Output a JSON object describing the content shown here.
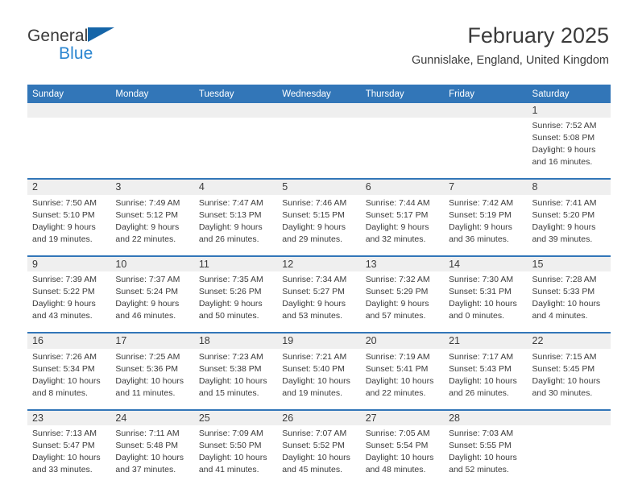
{
  "brand": {
    "name_top": "General",
    "name_bottom": "Blue",
    "triangle_color": "#1565a8",
    "bottom_color": "#2a85d0"
  },
  "header": {
    "title": "February 2025",
    "location": "Gunnislake, England, United Kingdom"
  },
  "theme": {
    "header_blue": "#3276b8",
    "date_band_gray": "#efefef",
    "text": "#3b3b3b"
  },
  "weekday_headers": [
    "Sunday",
    "Monday",
    "Tuesday",
    "Wednesday",
    "Thursday",
    "Friday",
    "Saturday"
  ],
  "weeks": [
    {
      "days": [
        {
          "date": "",
          "sunrise": "",
          "sunset": "",
          "daylight_line1": "",
          "daylight_line2": "",
          "empty": true
        },
        {
          "date": "",
          "sunrise": "",
          "sunset": "",
          "daylight_line1": "",
          "daylight_line2": "",
          "empty": true
        },
        {
          "date": "",
          "sunrise": "",
          "sunset": "",
          "daylight_line1": "",
          "daylight_line2": "",
          "empty": true
        },
        {
          "date": "",
          "sunrise": "",
          "sunset": "",
          "daylight_line1": "",
          "daylight_line2": "",
          "empty": true
        },
        {
          "date": "",
          "sunrise": "",
          "sunset": "",
          "daylight_line1": "",
          "daylight_line2": "",
          "empty": true
        },
        {
          "date": "",
          "sunrise": "",
          "sunset": "",
          "daylight_line1": "",
          "daylight_line2": "",
          "empty": true
        },
        {
          "date": "1",
          "sunrise": "Sunrise: 7:52 AM",
          "sunset": "Sunset: 5:08 PM",
          "daylight_line1": "Daylight: 9 hours",
          "daylight_line2": "and 16 minutes.",
          "empty": false
        }
      ]
    },
    {
      "days": [
        {
          "date": "2",
          "sunrise": "Sunrise: 7:50 AM",
          "sunset": "Sunset: 5:10 PM",
          "daylight_line1": "Daylight: 9 hours",
          "daylight_line2": "and 19 minutes.",
          "empty": false
        },
        {
          "date": "3",
          "sunrise": "Sunrise: 7:49 AM",
          "sunset": "Sunset: 5:12 PM",
          "daylight_line1": "Daylight: 9 hours",
          "daylight_line2": "and 22 minutes.",
          "empty": false
        },
        {
          "date": "4",
          "sunrise": "Sunrise: 7:47 AM",
          "sunset": "Sunset: 5:13 PM",
          "daylight_line1": "Daylight: 9 hours",
          "daylight_line2": "and 26 minutes.",
          "empty": false
        },
        {
          "date": "5",
          "sunrise": "Sunrise: 7:46 AM",
          "sunset": "Sunset: 5:15 PM",
          "daylight_line1": "Daylight: 9 hours",
          "daylight_line2": "and 29 minutes.",
          "empty": false
        },
        {
          "date": "6",
          "sunrise": "Sunrise: 7:44 AM",
          "sunset": "Sunset: 5:17 PM",
          "daylight_line1": "Daylight: 9 hours",
          "daylight_line2": "and 32 minutes.",
          "empty": false
        },
        {
          "date": "7",
          "sunrise": "Sunrise: 7:42 AM",
          "sunset": "Sunset: 5:19 PM",
          "daylight_line1": "Daylight: 9 hours",
          "daylight_line2": "and 36 minutes.",
          "empty": false
        },
        {
          "date": "8",
          "sunrise": "Sunrise: 7:41 AM",
          "sunset": "Sunset: 5:20 PM",
          "daylight_line1": "Daylight: 9 hours",
          "daylight_line2": "and 39 minutes.",
          "empty": false
        }
      ]
    },
    {
      "days": [
        {
          "date": "9",
          "sunrise": "Sunrise: 7:39 AM",
          "sunset": "Sunset: 5:22 PM",
          "daylight_line1": "Daylight: 9 hours",
          "daylight_line2": "and 43 minutes.",
          "empty": false
        },
        {
          "date": "10",
          "sunrise": "Sunrise: 7:37 AM",
          "sunset": "Sunset: 5:24 PM",
          "daylight_line1": "Daylight: 9 hours",
          "daylight_line2": "and 46 minutes.",
          "empty": false
        },
        {
          "date": "11",
          "sunrise": "Sunrise: 7:35 AM",
          "sunset": "Sunset: 5:26 PM",
          "daylight_line1": "Daylight: 9 hours",
          "daylight_line2": "and 50 minutes.",
          "empty": false
        },
        {
          "date": "12",
          "sunrise": "Sunrise: 7:34 AM",
          "sunset": "Sunset: 5:27 PM",
          "daylight_line1": "Daylight: 9 hours",
          "daylight_line2": "and 53 minutes.",
          "empty": false
        },
        {
          "date": "13",
          "sunrise": "Sunrise: 7:32 AM",
          "sunset": "Sunset: 5:29 PM",
          "daylight_line1": "Daylight: 9 hours",
          "daylight_line2": "and 57 minutes.",
          "empty": false
        },
        {
          "date": "14",
          "sunrise": "Sunrise: 7:30 AM",
          "sunset": "Sunset: 5:31 PM",
          "daylight_line1": "Daylight: 10 hours",
          "daylight_line2": "and 0 minutes.",
          "empty": false
        },
        {
          "date": "15",
          "sunrise": "Sunrise: 7:28 AM",
          "sunset": "Sunset: 5:33 PM",
          "daylight_line1": "Daylight: 10 hours",
          "daylight_line2": "and 4 minutes.",
          "empty": false
        }
      ]
    },
    {
      "days": [
        {
          "date": "16",
          "sunrise": "Sunrise: 7:26 AM",
          "sunset": "Sunset: 5:34 PM",
          "daylight_line1": "Daylight: 10 hours",
          "daylight_line2": "and 8 minutes.",
          "empty": false
        },
        {
          "date": "17",
          "sunrise": "Sunrise: 7:25 AM",
          "sunset": "Sunset: 5:36 PM",
          "daylight_line1": "Daylight: 10 hours",
          "daylight_line2": "and 11 minutes.",
          "empty": false
        },
        {
          "date": "18",
          "sunrise": "Sunrise: 7:23 AM",
          "sunset": "Sunset: 5:38 PM",
          "daylight_line1": "Daylight: 10 hours",
          "daylight_line2": "and 15 minutes.",
          "empty": false
        },
        {
          "date": "19",
          "sunrise": "Sunrise: 7:21 AM",
          "sunset": "Sunset: 5:40 PM",
          "daylight_line1": "Daylight: 10 hours",
          "daylight_line2": "and 19 minutes.",
          "empty": false
        },
        {
          "date": "20",
          "sunrise": "Sunrise: 7:19 AM",
          "sunset": "Sunset: 5:41 PM",
          "daylight_line1": "Daylight: 10 hours",
          "daylight_line2": "and 22 minutes.",
          "empty": false
        },
        {
          "date": "21",
          "sunrise": "Sunrise: 7:17 AM",
          "sunset": "Sunset: 5:43 PM",
          "daylight_line1": "Daylight: 10 hours",
          "daylight_line2": "and 26 minutes.",
          "empty": false
        },
        {
          "date": "22",
          "sunrise": "Sunrise: 7:15 AM",
          "sunset": "Sunset: 5:45 PM",
          "daylight_line1": "Daylight: 10 hours",
          "daylight_line2": "and 30 minutes.",
          "empty": false
        }
      ]
    },
    {
      "days": [
        {
          "date": "23",
          "sunrise": "Sunrise: 7:13 AM",
          "sunset": "Sunset: 5:47 PM",
          "daylight_line1": "Daylight: 10 hours",
          "daylight_line2": "and 33 minutes.",
          "empty": false
        },
        {
          "date": "24",
          "sunrise": "Sunrise: 7:11 AM",
          "sunset": "Sunset: 5:48 PM",
          "daylight_line1": "Daylight: 10 hours",
          "daylight_line2": "and 37 minutes.",
          "empty": false
        },
        {
          "date": "25",
          "sunrise": "Sunrise: 7:09 AM",
          "sunset": "Sunset: 5:50 PM",
          "daylight_line1": "Daylight: 10 hours",
          "daylight_line2": "and 41 minutes.",
          "empty": false
        },
        {
          "date": "26",
          "sunrise": "Sunrise: 7:07 AM",
          "sunset": "Sunset: 5:52 PM",
          "daylight_line1": "Daylight: 10 hours",
          "daylight_line2": "and 45 minutes.",
          "empty": false
        },
        {
          "date": "27",
          "sunrise": "Sunrise: 7:05 AM",
          "sunset": "Sunset: 5:54 PM",
          "daylight_line1": "Daylight: 10 hours",
          "daylight_line2": "and 48 minutes.",
          "empty": false
        },
        {
          "date": "28",
          "sunrise": "Sunrise: 7:03 AM",
          "sunset": "Sunset: 5:55 PM",
          "daylight_line1": "Daylight: 10 hours",
          "daylight_line2": "and 52 minutes.",
          "empty": false
        },
        {
          "date": "",
          "sunrise": "",
          "sunset": "",
          "daylight_line1": "",
          "daylight_line2": "",
          "empty": true
        }
      ]
    }
  ]
}
